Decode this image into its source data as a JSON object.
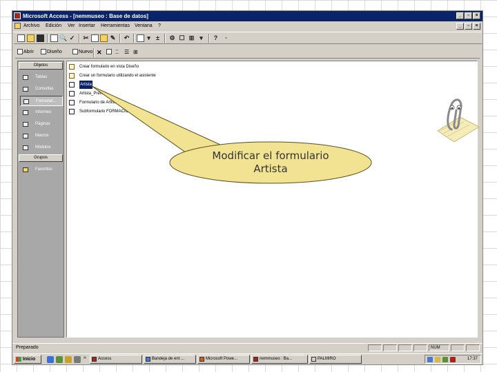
{
  "window": {
    "title": "Microsoft Access - [nemmuseo : Base de datos]"
  },
  "menu": {
    "items": [
      "Archivo",
      "Edición",
      "Ver",
      "Insertar",
      "Herramientas",
      "Ventana",
      "?"
    ]
  },
  "db_toolbar": {
    "open_label": "Abrir",
    "design_label": "Diseño",
    "new_label": "Nuevo"
  },
  "objects_bar": {
    "header": "Objetos",
    "items": [
      {
        "label": "Tablas",
        "icon": "table-icon"
      },
      {
        "label": "Consultas",
        "icon": "query-icon"
      },
      {
        "label": "Formulari...",
        "icon": "form-icon",
        "selected": true
      },
      {
        "label": "Informes",
        "icon": "report-icon"
      },
      {
        "label": "Páginas",
        "icon": "page-icon"
      },
      {
        "label": "Macros",
        "icon": "macro-icon"
      },
      {
        "label": "Módulos",
        "icon": "module-icon"
      }
    ],
    "groups_header": "Grupos",
    "favorites": "Favoritos"
  },
  "list": {
    "items": [
      {
        "label": "Crear formulario en vista Diseño",
        "type": "wizard"
      },
      {
        "label": "Crear un formulario utilizando el asistente",
        "type": "wizard"
      },
      {
        "label": "Artista",
        "type": "form",
        "selected": true
      },
      {
        "label": "Artista_Premio",
        "type": "form"
      },
      {
        "label": "Formulario de Artista",
        "type": "form"
      },
      {
        "label": "Subformulario FORMACION",
        "type": "form"
      }
    ]
  },
  "callout": {
    "text": "Modificar el formulario Artista"
  },
  "status": {
    "text": "Preparado",
    "num": "NUM"
  },
  "taskbar": {
    "start": "Inicio",
    "quick_launch_more": "»",
    "tasks": [
      "Access",
      "Bandeja de ent ...",
      "Microsoft Powe...",
      "nemmuseo : Ba...",
      "PALMIRO"
    ],
    "clock": "17:37"
  },
  "colors": {
    "titlebar": "#0a246a",
    "face": "#d4d0c8",
    "objects_bar": "#a8a8a8",
    "callout_fill": "#f2e392",
    "callout_stroke": "#5a4e1a"
  }
}
